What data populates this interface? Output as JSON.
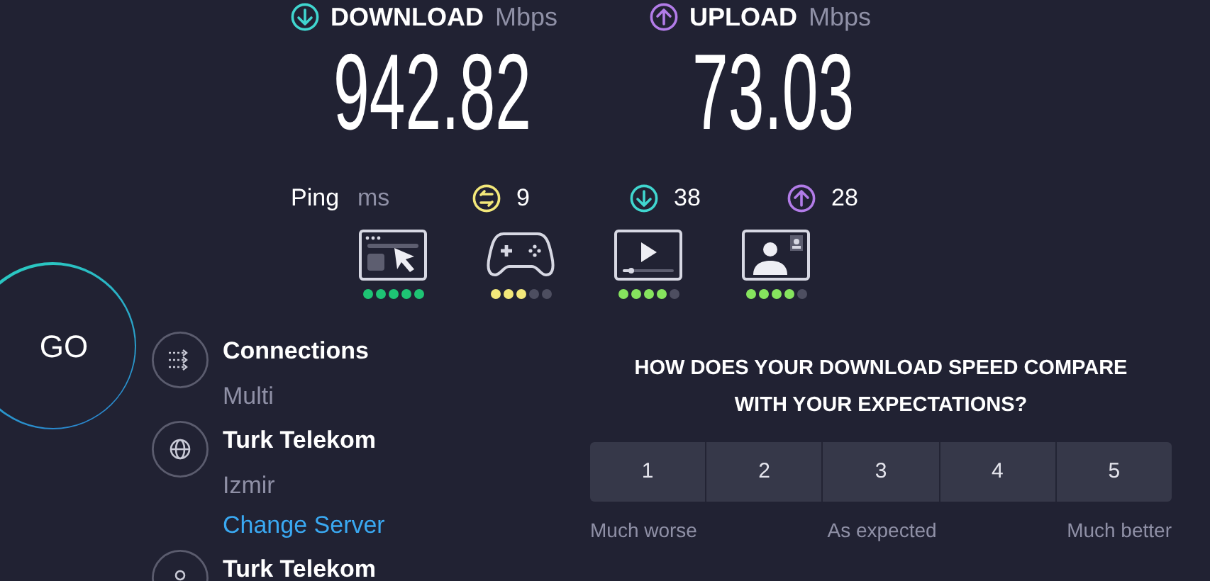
{
  "download": {
    "label": "DOWNLOAD",
    "unit": "Mbps",
    "value": "942.82"
  },
  "upload": {
    "label": "UPLOAD",
    "unit": "Mbps",
    "value": "73.03"
  },
  "ping": {
    "label": "Ping",
    "unit": "ms",
    "readings": [
      {
        "kind": "idle",
        "value": "9"
      },
      {
        "kind": "download",
        "value": "38"
      },
      {
        "kind": "upload",
        "value": "28"
      }
    ]
  },
  "quality": [
    {
      "kind": "browsing",
      "stars": 5,
      "color": "#1ec474"
    },
    {
      "kind": "gaming",
      "stars": 3,
      "color": "#f3e87a"
    },
    {
      "kind": "streaming",
      "stars": 4,
      "color": "#86e45e"
    },
    {
      "kind": "video_call",
      "stars": 4,
      "color": "#86e45e"
    }
  ],
  "go_button": "GO",
  "details": [
    {
      "kind": "connections",
      "title": "Connections",
      "subtitle": "Multi"
    },
    {
      "kind": "server",
      "title": "Turk Telekom",
      "subtitle": "Izmir",
      "link": "Change Server"
    },
    {
      "kind": "provider",
      "title": "Turk Telekom"
    }
  ],
  "survey": {
    "question": "HOW DOES YOUR DOWNLOAD SPEED COMPARE WITH YOUR EXPECTATIONS?",
    "options": [
      {
        "label": "1",
        "selected": false
      },
      {
        "label": "2",
        "selected": false
      },
      {
        "label": "3",
        "selected": false
      },
      {
        "label": "4",
        "selected": false
      },
      {
        "label": "5",
        "selected": false
      }
    ],
    "scale_labels": [
      "Much worse",
      "As expected",
      "Much better"
    ]
  }
}
